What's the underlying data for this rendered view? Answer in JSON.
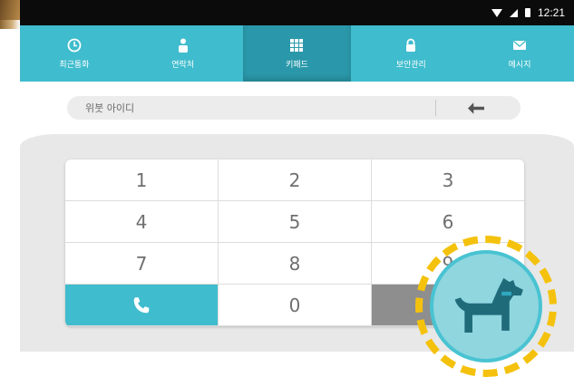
{
  "status_bar": {
    "time": "12:21",
    "icons": [
      "wifi-icon",
      "signal-icon",
      "battery-icon"
    ]
  },
  "tabs": [
    {
      "label": "최근통화",
      "icon": "clock-icon"
    },
    {
      "label": "연락처",
      "icon": "person-icon"
    },
    {
      "label": "키패드",
      "icon": "keypad-icon",
      "active": true
    },
    {
      "label": "보안관리",
      "icon": "lock-icon"
    },
    {
      "label": "메시지",
      "icon": "envelope-icon"
    }
  ],
  "search": {
    "placeholder": "위붓 아이디",
    "back_icon": "back-arrow-icon"
  },
  "keypad": {
    "rows": [
      [
        "1",
        "2",
        "3"
      ],
      [
        "4",
        "5",
        "6"
      ],
      [
        "7",
        "8",
        "9"
      ]
    ],
    "bottom": {
      "left_icon": "phone-icon",
      "center": "0",
      "right_icon": "video-call-icon"
    }
  },
  "overlay": {
    "icon": "dog-icon"
  },
  "colors": {
    "accent": "#3fbccd",
    "accent_dark": "#2a98aa",
    "badge_ring": "#f4c20d"
  }
}
